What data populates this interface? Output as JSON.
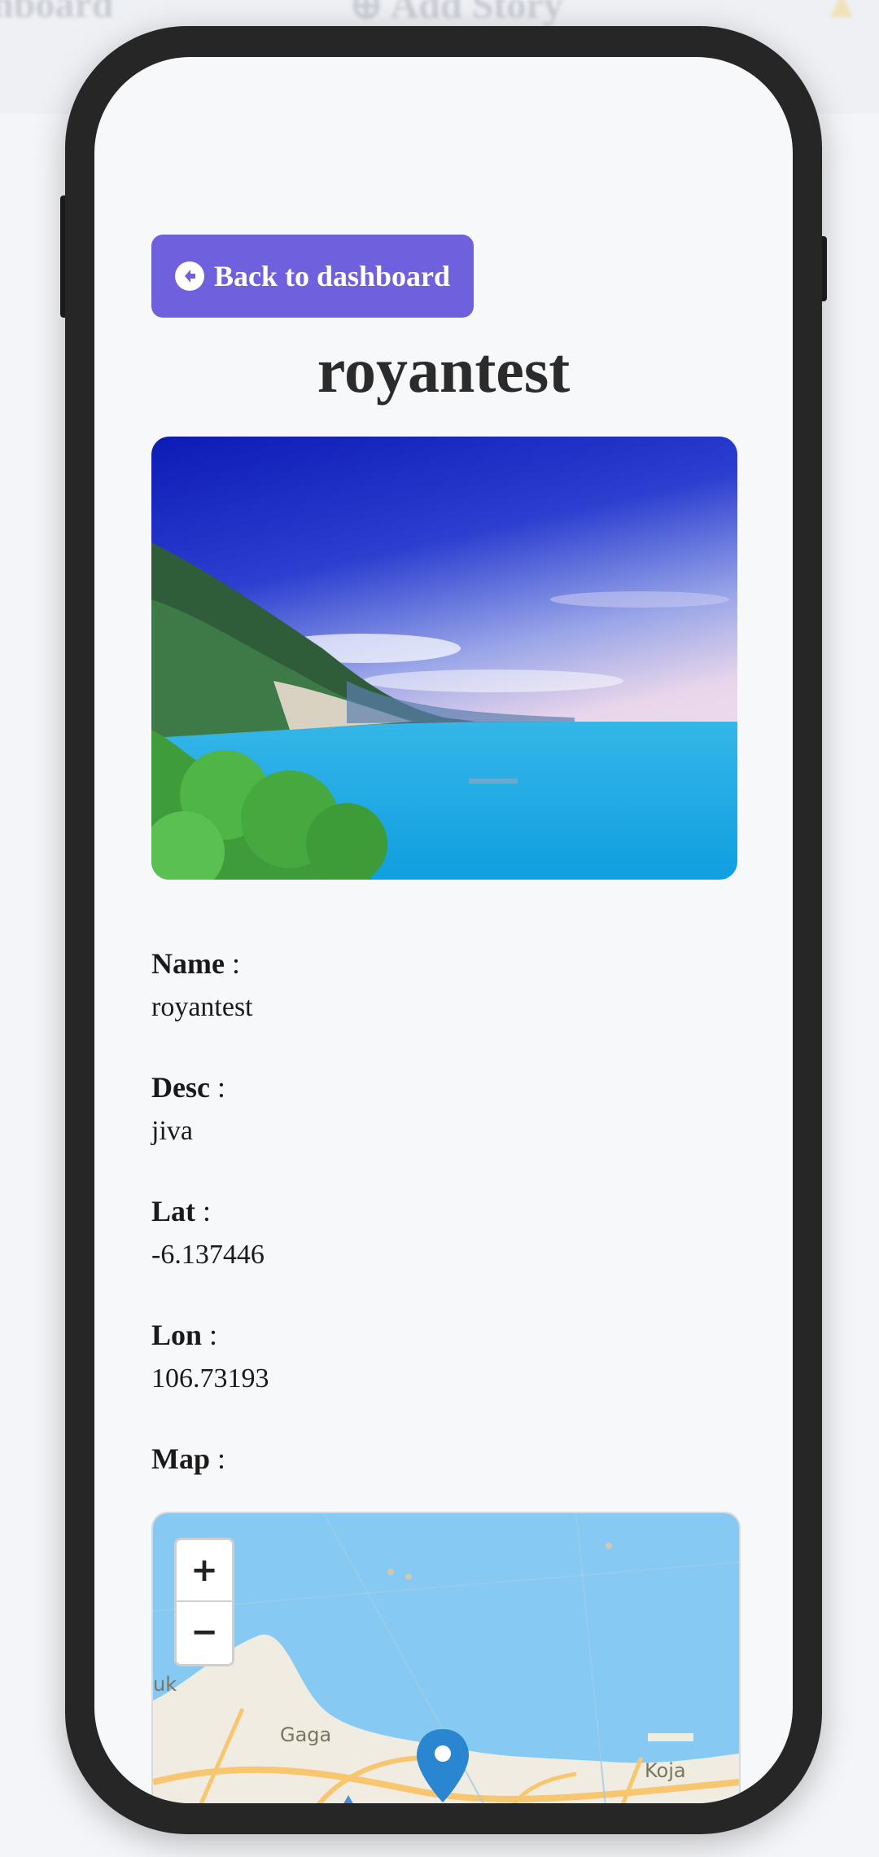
{
  "background_header": {
    "title": "nboard",
    "add_story": "Add Story"
  },
  "back_button": {
    "label": "Back to dashboard",
    "icon": "arrow-left-circle-icon"
  },
  "page_title": "royantest",
  "story_image": {
    "alt": "Coastal landscape with blue sea and green hills"
  },
  "fields": {
    "name": {
      "label": "Name",
      "colon": ":",
      "value": "royantest"
    },
    "desc": {
      "label": "Desc",
      "colon": ":",
      "value": "jiva"
    },
    "lat": {
      "label": "Lat",
      "colon": ":",
      "value": "-6.137446"
    },
    "lon": {
      "label": "Lon",
      "colon": ":",
      "value": "106.73193"
    },
    "map": {
      "label": "Map",
      "colon": ":"
    }
  },
  "map": {
    "zoom_in": "+",
    "zoom_out": "−",
    "labels": {
      "left": "uk",
      "gaga": "Gaga",
      "koja": "Koja"
    },
    "colors": {
      "water": "#86c9f2",
      "land": "#f1ece2",
      "road": "#f7c66e",
      "marker": "#2a86d0"
    }
  },
  "colors": {
    "accent": "#6f61dd",
    "screen_bg": "#f7f8fa",
    "phone_frame": "#262626"
  }
}
